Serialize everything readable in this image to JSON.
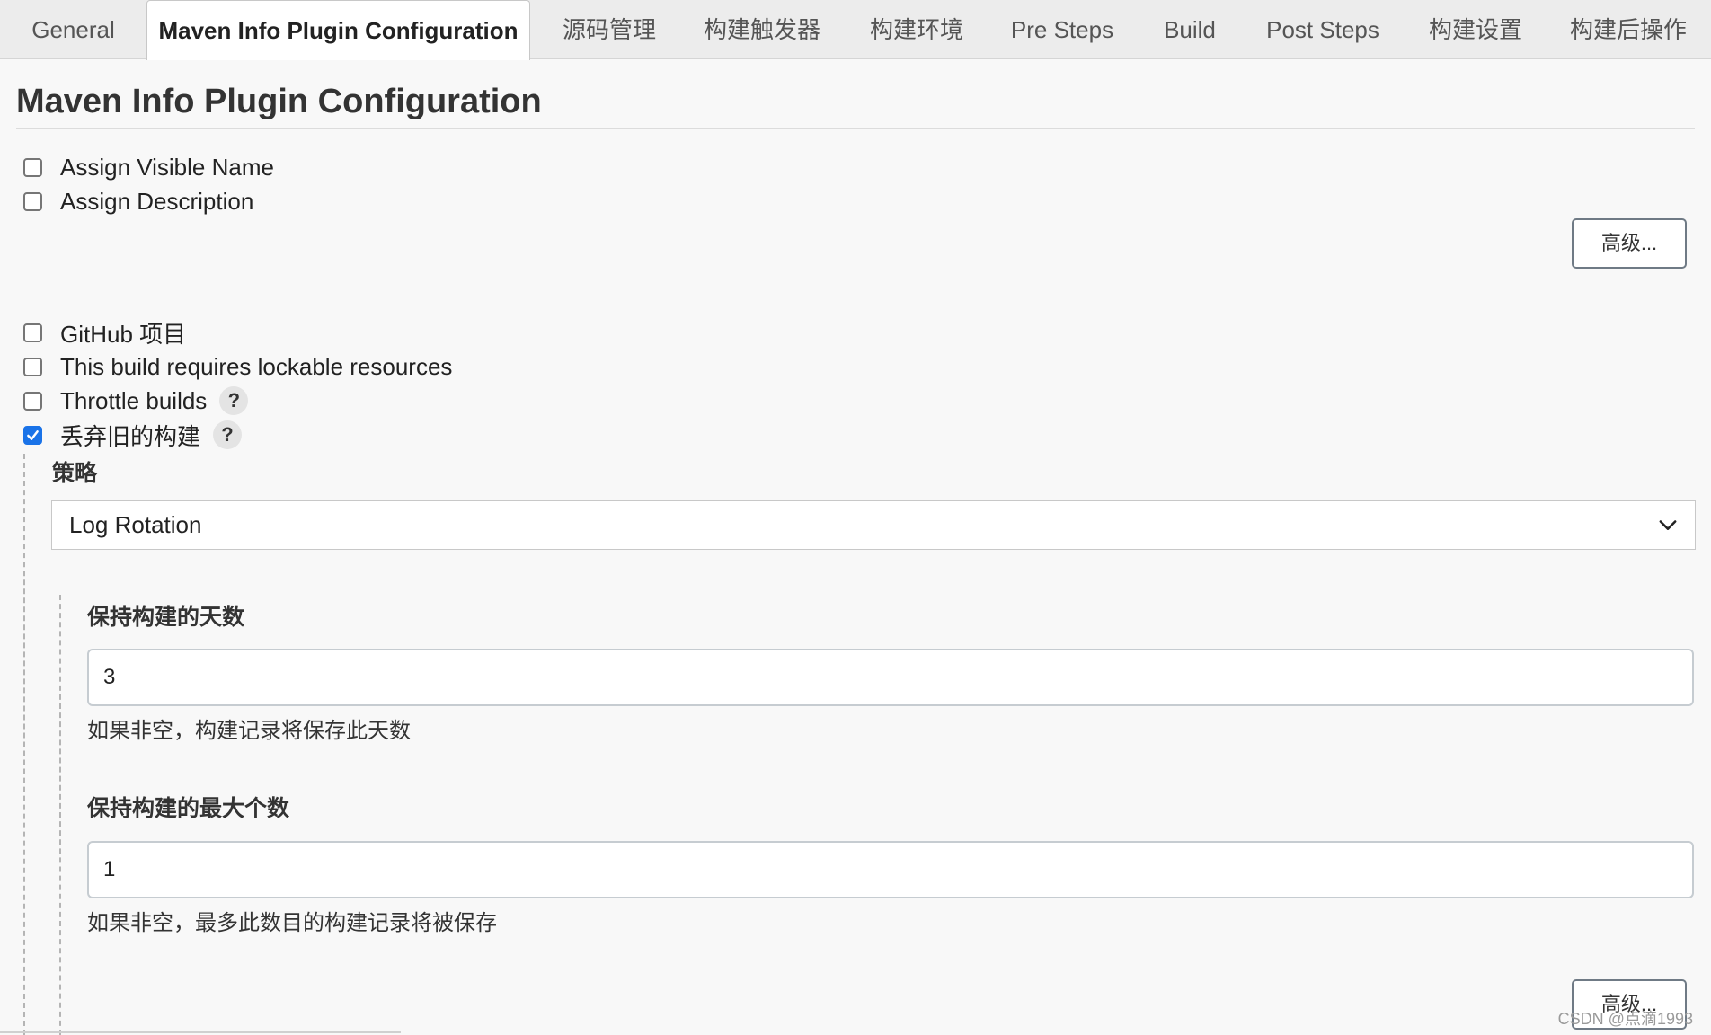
{
  "tabs": [
    {
      "label": "General",
      "active": false
    },
    {
      "label": "Maven Info Plugin Configuration",
      "active": true
    },
    {
      "label": "源码管理",
      "active": false
    },
    {
      "label": "构建触发器",
      "active": false
    },
    {
      "label": "构建环境",
      "active": false
    },
    {
      "label": "Pre Steps",
      "active": false
    },
    {
      "label": "Build",
      "active": false
    },
    {
      "label": "Post Steps",
      "active": false
    },
    {
      "label": "构建设置",
      "active": false
    },
    {
      "label": "构建后操作",
      "active": false
    }
  ],
  "section": {
    "title": "Maven Info Plugin Configuration"
  },
  "maven_options": [
    {
      "label": "Assign Visible Name",
      "checked": false
    },
    {
      "label": "Assign Description",
      "checked": false
    }
  ],
  "advanced_button_label": "高级...",
  "general_options": [
    {
      "label": "GitHub 项目",
      "checked": false
    },
    {
      "label": "This build requires lockable resources",
      "checked": false
    },
    {
      "label": "Throttle builds",
      "checked": false,
      "help": "?"
    },
    {
      "label": "丢弃旧的构建",
      "checked": true,
      "help": "?"
    }
  ],
  "discard": {
    "strategy_label": "策略",
    "strategy_value": "Log Rotation",
    "days_label": "保持构建的天数",
    "days_value": "3",
    "days_hint": "如果非空，构建记录将保存此天数",
    "max_label": "保持构建的最大个数",
    "max_value": "1",
    "max_hint": "如果非空，最多此数目的构建记录将被保存",
    "advanced_label": "高级..."
  },
  "watermark": "CSDN @点滴1993",
  "colors": {
    "accent": "#1a73e8",
    "tabbar": "#ececec",
    "background": "#f8f8f8"
  }
}
